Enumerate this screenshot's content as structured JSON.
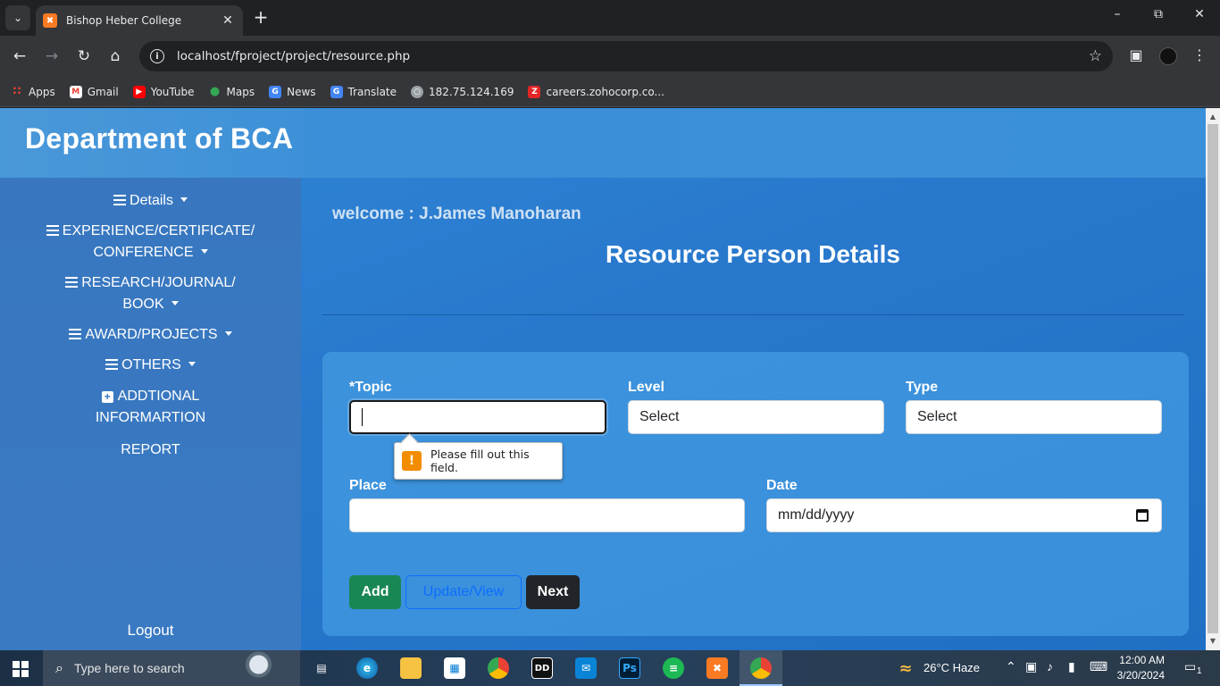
{
  "browser": {
    "tab_title": "Bishop Heber College",
    "url_host": "localhost",
    "url_path": "/fproject/project/resource.php",
    "bookmarks": [
      {
        "label": "Apps",
        "icon": "apps-grid-icon",
        "color": "#ea4335"
      },
      {
        "label": "Gmail",
        "icon": "gmail-icon",
        "color": "#ea4335"
      },
      {
        "label": "YouTube",
        "icon": "youtube-icon",
        "color": "#ff0000"
      },
      {
        "label": "Maps",
        "icon": "maps-pin-icon",
        "color": "#34a853"
      },
      {
        "label": "News",
        "icon": "news-icon",
        "color": "#4285f4"
      },
      {
        "label": "Translate",
        "icon": "translate-icon",
        "color": "#4285f4"
      },
      {
        "label": "182.75.124.169",
        "icon": "globe-icon",
        "color": "#9aa0a6"
      },
      {
        "label": "careers.zohocorp.co...",
        "icon": "zoho-icon",
        "color": "#e42527"
      }
    ]
  },
  "header": {
    "title": "Department of BCA"
  },
  "sidebar": {
    "items": [
      {
        "line1": "Details",
        "line2": ""
      },
      {
        "line1": "EXPERIENCE/CERTIFICATE/",
        "line2": "CONFERENCE"
      },
      {
        "line1": "RESEARCH/JOURNAL/",
        "line2": "BOOK"
      },
      {
        "line1": "AWARD/PROJECTS",
        "line2": ""
      },
      {
        "line1": "OTHERS",
        "line2": ""
      },
      {
        "line1": "ADDTIONAL",
        "line2": "INFORMARTION"
      },
      {
        "line1": "REPORT",
        "line2": ""
      }
    ],
    "logout": "Logout"
  },
  "main": {
    "welcome": "welcome : J.James Manoharan",
    "title": "Resource Person Details",
    "form": {
      "topic_label": "*Topic",
      "topic_value": "",
      "level_label": "Level",
      "level_value": "Select",
      "type_label": "Type",
      "type_value": "Select",
      "place_label": "Place",
      "place_value": "",
      "date_label": "Date",
      "date_placeholder": "mm/dd/yyyy",
      "validation_message": "Please fill out this field."
    },
    "buttons": {
      "add": "Add",
      "update": "Update/View",
      "next": "Next"
    }
  },
  "taskbar": {
    "search_placeholder": "Type here to search",
    "weather": "26°C  Haze",
    "time": "12:00 AM",
    "date": "3/20/2024",
    "notification_count": "1"
  },
  "colors": {
    "page_blue": "#2878cc",
    "sidebar_blue": "#3877bf",
    "add_green": "#198754",
    "update_blue": "#0d6efd",
    "next_dark": "#212529",
    "warning_orange": "#f28c00"
  }
}
